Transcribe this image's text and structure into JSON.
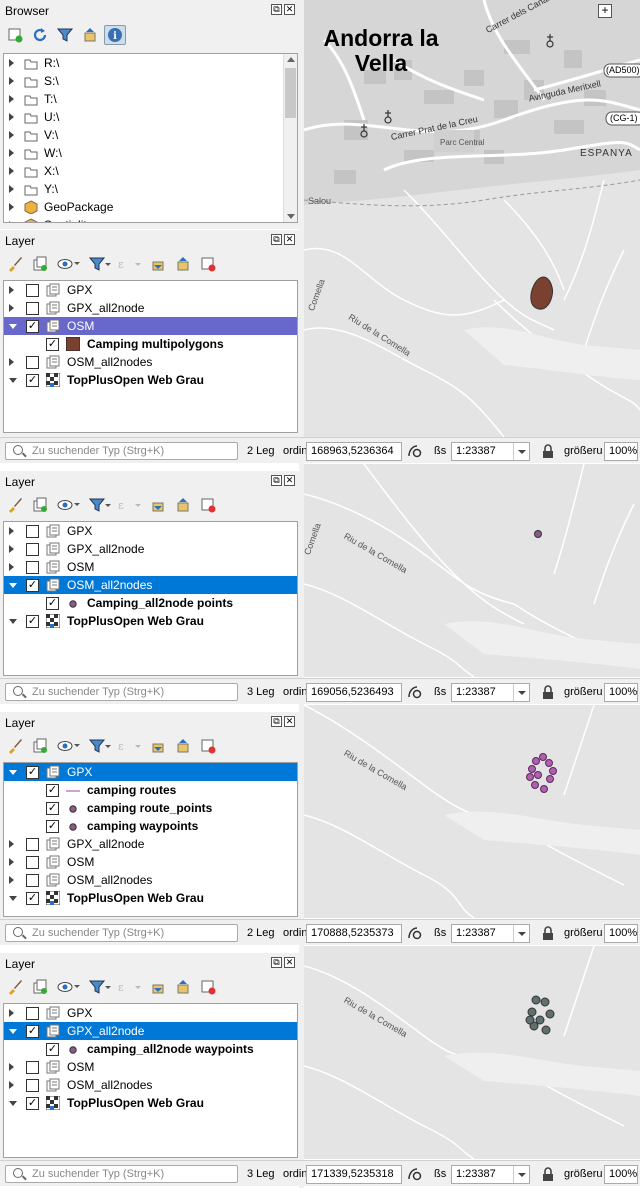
{
  "browser": {
    "title": "Browser",
    "items": [
      "R:\\",
      "S:\\",
      "T:\\",
      "U:\\",
      "V:\\",
      "W:\\",
      "X:\\",
      "Y:\\",
      "GeoPackage",
      "Spatialite"
    ]
  },
  "dock_buttons": {
    "float": "⧉",
    "close": "✕"
  },
  "panels": [
    {
      "title": "Layer",
      "legend_count": "2 Leg",
      "coord_label": "ordin",
      "coord": "168963,5236364",
      "scale_label": "ßs",
      "scale": "1:23387",
      "magnifier_label": "größeru",
      "magnifier": "100%",
      "rows": [
        {
          "label": "GPX",
          "level": 0,
          "expanded": false,
          "checked": false,
          "icon": "gpx-layer-icon",
          "bold": false,
          "selected": false
        },
        {
          "label": "GPX_all2node",
          "level": 0,
          "expanded": false,
          "checked": false,
          "icon": "gpx-layer-icon",
          "bold": false,
          "selected": false
        },
        {
          "label": "OSM",
          "level": 0,
          "expanded": true,
          "checked": true,
          "icon": "gpx-layer-icon",
          "bold": false,
          "selected": "purple"
        },
        {
          "label": "Camping multipolygons",
          "level": 1,
          "checked": true,
          "icon": "polygon-symbol",
          "bold": true
        },
        {
          "label": "OSM_all2nodes",
          "level": 0,
          "expanded": false,
          "checked": false,
          "icon": "gpx-layer-icon",
          "bold": false
        },
        {
          "label": "TopPlusOpen Web Grau",
          "level": 0,
          "expanded": true,
          "checked": true,
          "icon": "tile-layer-icon",
          "bold": true
        }
      ]
    },
    {
      "title": "Layer",
      "legend_count": "3 Leg",
      "coord_label": "ordin",
      "coord": "169056,5236493",
      "scale_label": "ßs",
      "scale": "1:23387",
      "magnifier_label": "größeru",
      "magnifier": "100%",
      "rows": [
        {
          "label": "GPX",
          "level": 0,
          "expanded": false,
          "checked": false,
          "icon": "gpx-layer-icon",
          "bold": false
        },
        {
          "label": "GPX_all2node",
          "level": 0,
          "expanded": false,
          "checked": false,
          "icon": "gpx-layer-icon",
          "bold": false
        },
        {
          "label": "OSM",
          "level": 0,
          "expanded": false,
          "checked": false,
          "icon": "gpx-layer-icon",
          "bold": false
        },
        {
          "label": "OSM_all2nodes",
          "level": 0,
          "expanded": true,
          "checked": true,
          "icon": "gpx-layer-icon",
          "bold": false,
          "selected": "blue"
        },
        {
          "label": "Camping_all2node points",
          "level": 1,
          "checked": true,
          "icon": "point-symbol",
          "bold": true
        },
        {
          "label": "TopPlusOpen Web Grau",
          "level": 0,
          "expanded": true,
          "checked": true,
          "icon": "tile-layer-icon",
          "bold": true
        }
      ]
    },
    {
      "title": "Layer",
      "legend_count": "2 Leg",
      "coord_label": "ordin",
      "coord": "170888,5235373",
      "scale_label": "ßs",
      "scale": "1:23387",
      "magnifier_label": "größeru",
      "magnifier": "100%",
      "rows": [
        {
          "label": "GPX",
          "level": 0,
          "expanded": true,
          "checked": true,
          "icon": "gpx-layer-icon",
          "bold": false,
          "selected": "blue"
        },
        {
          "label": "camping routes",
          "level": 1,
          "checked": true,
          "icon": "line-symbol",
          "bold": true
        },
        {
          "label": "camping route_points",
          "level": 1,
          "checked": true,
          "icon": "point-symbol",
          "bold": true
        },
        {
          "label": "camping waypoints",
          "level": 1,
          "checked": true,
          "icon": "point-symbol",
          "bold": true
        },
        {
          "label": "GPX_all2node",
          "level": 0,
          "expanded": false,
          "checked": false,
          "icon": "gpx-layer-icon",
          "bold": false
        },
        {
          "label": "OSM",
          "level": 0,
          "expanded": false,
          "checked": false,
          "icon": "gpx-layer-icon",
          "bold": false
        },
        {
          "label": "OSM_all2nodes",
          "level": 0,
          "expanded": false,
          "checked": false,
          "icon": "gpx-layer-icon",
          "bold": false
        },
        {
          "label": "TopPlusOpen Web Grau",
          "level": 0,
          "expanded": true,
          "checked": true,
          "icon": "tile-layer-icon",
          "bold": true
        }
      ]
    },
    {
      "title": "Layer",
      "legend_count": "3 Leg",
      "coord_label": "ordin",
      "coord": "171339,5235318",
      "scale_label": "ßs",
      "scale": "1:23387",
      "magnifier_label": "größeru",
      "magnifier": "100%",
      "rows": [
        {
          "label": "GPX",
          "level": 0,
          "expanded": false,
          "checked": false,
          "icon": "gpx-layer-icon",
          "bold": false
        },
        {
          "label": "GPX_all2node",
          "level": 0,
          "expanded": true,
          "checked": true,
          "icon": "gpx-layer-icon",
          "bold": false,
          "selected": "blue"
        },
        {
          "label": "camping_all2node waypoints",
          "level": 1,
          "checked": true,
          "icon": "point-symbol",
          "bold": true
        },
        {
          "label": "OSM",
          "level": 0,
          "expanded": false,
          "checked": false,
          "icon": "gpx-layer-icon",
          "bold": false
        },
        {
          "label": "OSM_all2nodes",
          "level": 0,
          "expanded": false,
          "checked": false,
          "icon": "gpx-layer-icon",
          "bold": false
        },
        {
          "label": "TopPlusOpen Web Grau",
          "level": 0,
          "expanded": true,
          "checked": true,
          "icon": "tile-layer-icon",
          "bold": true
        }
      ]
    }
  ],
  "search_placeholder": "Zu suchender Typ (Strg+K)",
  "map": {
    "city_line1": "Andorra la",
    "city_line2": "Vella",
    "street_labels": [
      "Carrer dels Canals",
      "Avinguda Meritxell",
      "Carrer Prat de la Creu",
      "Parc Central",
      "ESPANYA",
      "Salou",
      "Riu de la Comella",
      "Comella"
    ],
    "road_badges": [
      "(AD500)",
      "(CG-1)"
    ],
    "colors": {
      "polygon": "#7a4030",
      "point": "#8a5a8a",
      "route_point": "#b060b0",
      "node_point": "#607070",
      "selected_purple": "#6767cc",
      "selected_blue": "#0078d7"
    }
  }
}
